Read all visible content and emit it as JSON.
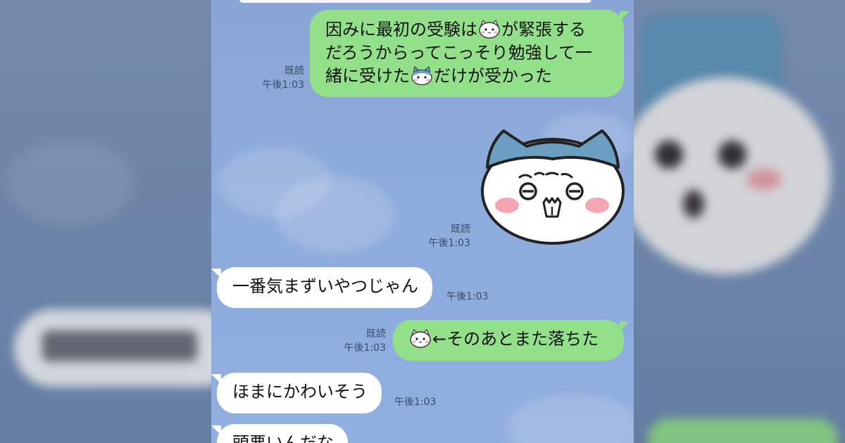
{
  "conversation": {
    "messages": [
      {
        "direction": "outgoing",
        "lines": [
          "因みに最初の受験は",
          "が緊張する",
          "だろうからってこっそり勉強して一",
          "緒に受けた",
          "だけが受かった"
        ],
        "read_label": "既読",
        "time": "午後1:03"
      },
      {
        "direction": "outgoing",
        "type": "sticker",
        "sticker_name": "white-cat-blue-hat-sticker",
        "read_label": "既読",
        "time": "午後1:03"
      },
      {
        "direction": "incoming",
        "text": "一番気まずいやつじゃん",
        "time": "午後1:03"
      },
      {
        "direction": "outgoing",
        "text": "←そのあとまた落ちた",
        "read_label": "既読",
        "time": "午後1:03"
      },
      {
        "direction": "incoming",
        "text": "ほまにかわいそう",
        "time": "午後1:03"
      },
      {
        "direction": "incoming",
        "text": "頭悪いんだな",
        "partial": true
      }
    ]
  },
  "colors": {
    "chat_bg": "#8dabdc",
    "outgoing_bubble": "#93e08a",
    "incoming_bubble": "#ffffff",
    "meta_text": "#3a4b66",
    "sticker_hat": "#6b9fc2"
  },
  "icons": [
    "white-cat-emoji",
    "hachiware-emoji"
  ]
}
